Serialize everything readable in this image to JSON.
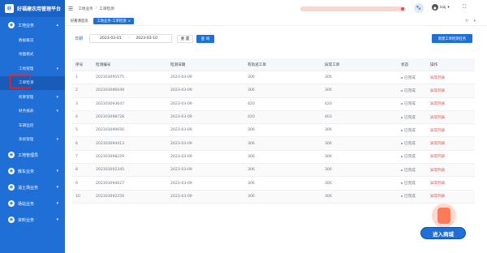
{
  "app": {
    "title": "好福建农用管理平台",
    "logo_text": "好"
  },
  "sidebar": {
    "groups": [
      {
        "label": "工地业务",
        "items": [
          {
            "label": "数据概况"
          },
          {
            "label": "地图模式"
          },
          {
            "label": "工地管理",
            "has_children": true
          },
          {
            "label": "工单检测",
            "active": true
          },
          {
            "label": "统筹管理",
            "has_children": true
          },
          {
            "label": "财务报表",
            "has_children": true
          },
          {
            "label": "车辆监控"
          },
          {
            "label": "系统管理",
            "has_children": true
          }
        ]
      },
      {
        "label": "工地管理员"
      },
      {
        "label": "散车业务"
      },
      {
        "label": "消土场业务"
      },
      {
        "label": "场站业务"
      },
      {
        "label": "资料业务"
      }
    ]
  },
  "topbar": {
    "breadcrumb": [
      "工地业务",
      "工单检测"
    ],
    "user_name": "lzzj"
  },
  "tabs": [
    {
      "label": "好看清首页",
      "active": false
    },
    {
      "label": "工地业务-工单检测",
      "active": true
    }
  ],
  "filters": {
    "date_label": "日期",
    "start_date": "2023-03-01",
    "end_date": "2023-03-10",
    "reset_label": "重 置",
    "query_label": "查 询",
    "new_label": "新建工单检测任务"
  },
  "table": {
    "headers": [
      "序号",
      "检测编号",
      "检测日期",
      "有轨迹工单",
      "异常工单",
      "状态",
      "操作"
    ],
    "rows": [
      [
        "1",
        "202303095575",
        "2023-03-09",
        "306",
        "306",
        "已完成",
        "异常列表"
      ],
      [
        "2",
        "202303096049",
        "2023-03-09",
        "306",
        "306",
        "已完成",
        "异常列表"
      ],
      [
        "3",
        "202303093647",
        "2023-03-09",
        "420",
        "420",
        "已完成",
        "异常列表"
      ],
      [
        "4",
        "202303098728",
        "2023-03-09",
        "420",
        "403",
        "已完成",
        "异常列表"
      ],
      [
        "5",
        "202303099656",
        "2023-03-09",
        "306",
        "306",
        "已完成",
        "异常列表"
      ],
      [
        "6",
        "202303094413",
        "2023-03-09",
        "306",
        "306",
        "已完成",
        "异常列表"
      ],
      [
        "7",
        "202303098229",
        "2023-03-09",
        "306",
        "306",
        "已完成",
        "异常列表"
      ],
      [
        "8",
        "202303092345",
        "2023-03-09",
        "306",
        "306",
        "已完成",
        "异常列表"
      ],
      [
        "9",
        "202303094027",
        "2023-03-09",
        "306",
        "306",
        "已完成",
        "异常列表"
      ],
      [
        "10",
        "202303092259",
        "2023-03-09",
        "306",
        "306",
        "已完成",
        "异常列表"
      ]
    ]
  },
  "promo": {
    "label": "进入商城"
  },
  "colors": {
    "primary": "#1f6fd6",
    "danger": "#e24a4a",
    "highlight_box": "#e0282e"
  }
}
